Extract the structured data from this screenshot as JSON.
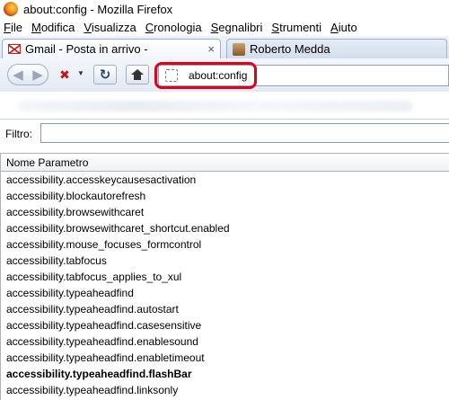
{
  "window": {
    "title": "about:config - Mozilla Firefox"
  },
  "menu": [
    "File",
    "Modifica",
    "Visualizza",
    "Cronologia",
    "Segnalibri",
    "Strumenti",
    "Aiuto"
  ],
  "tabs": [
    {
      "label": "Gmail - Posta in arrivo -",
      "icon": "gmail-icon",
      "active": true
    },
    {
      "label": "Roberto Medda",
      "icon": "avatar-icon",
      "active": false
    }
  ],
  "tab_close_glyph": "×",
  "nav": {
    "back_glyph": "◀",
    "forward_glyph": "▶",
    "stop_glyph": "✖",
    "dropdown_glyph": "▼",
    "reload_glyph": "↻",
    "url": "about:config",
    "highlight_color": "#e0001b"
  },
  "filter": {
    "label": "Filtro:",
    "value": ""
  },
  "table": {
    "column_header": "Nome Parametro",
    "rows": [
      {
        "name": "accessibility.accesskeycausesactivation",
        "bold": false
      },
      {
        "name": "accessibility.blockautorefresh",
        "bold": false
      },
      {
        "name": "accessibility.browsewithcaret",
        "bold": false
      },
      {
        "name": "accessibility.browsewithcaret_shortcut.enabled",
        "bold": false
      },
      {
        "name": "accessibility.mouse_focuses_formcontrol",
        "bold": false
      },
      {
        "name": "accessibility.tabfocus",
        "bold": false
      },
      {
        "name": "accessibility.tabfocus_applies_to_xul",
        "bold": false
      },
      {
        "name": "accessibility.typeaheadfind",
        "bold": false
      },
      {
        "name": "accessibility.typeaheadfind.autostart",
        "bold": false
      },
      {
        "name": "accessibility.typeaheadfind.casesensitive",
        "bold": false
      },
      {
        "name": "accessibility.typeaheadfind.enablesound",
        "bold": false
      },
      {
        "name": "accessibility.typeaheadfind.enabletimeout",
        "bold": false
      },
      {
        "name": "accessibility.typeaheadfind.flashBar",
        "bold": true
      },
      {
        "name": "accessibility.typeaheadfind.linksonly",
        "bold": false
      }
    ]
  }
}
